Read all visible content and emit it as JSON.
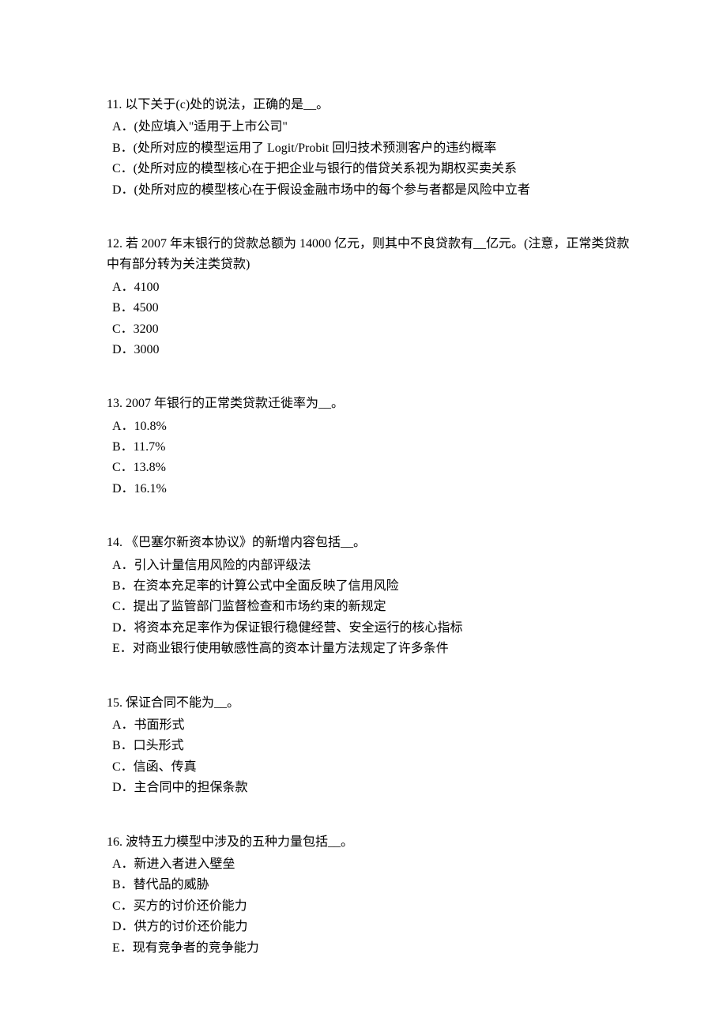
{
  "questions": [
    {
      "number": "11.",
      "stem": "以下关于(c)处的说法，正确的是__。",
      "options": [
        "A．(处应填入\"适用于上市公司\"",
        "B．(处所对应的模型运用了 Logit/Probit 回归技术预测客户的违约概率",
        "C．(处所对应的模型核心在于把企业与银行的借贷关系视为期权买卖关系",
        "D．(处所对应的模型核心在于假设金融市场中的每个参与者都是风险中立者"
      ]
    },
    {
      "number": "12.",
      "stem": "若 2007 年末银行的贷款总额为 14000 亿元，则其中不良贷款有__亿元。(注意，正常类贷款中有部分转为关注类贷款)",
      "options": [
        "A．4100",
        "B．4500",
        "C．3200",
        "D．3000"
      ]
    },
    {
      "number": "13.",
      "stem": "2007 年银行的正常类贷款迁徙率为__。",
      "options": [
        "A．10.8%",
        "B．11.7%",
        "C．13.8%",
        "D．16.1%"
      ]
    },
    {
      "number": "14.",
      "stem": "《巴塞尔新资本协议》的新增内容包括__。",
      "options": [
        "A．引入计量信用风险的内部评级法",
        "B．在资本充足率的计算公式中全面反映了信用风险",
        "C．提出了监管部门监督检查和市场约束的新规定",
        "D．将资本充足率作为保证银行稳健经营、安全运行的核心指标",
        "E．对商业银行使用敏感性高的资本计量方法规定了许多条件"
      ]
    },
    {
      "number": "15.",
      "stem": "保证合同不能为__。",
      "options": [
        "A．书面形式",
        "B．口头形式",
        "C．信函、传真",
        "D．主合同中的担保条款"
      ]
    },
    {
      "number": "16.",
      "stem": "波特五力模型中涉及的五种力量包括__。",
      "options": [
        "A．新进入者进入壁垒",
        "B．替代品的威胁",
        "C．买方的讨价还价能力",
        "D．供方的讨价还价能力",
        "E．现有竞争者的竞争能力"
      ]
    }
  ]
}
